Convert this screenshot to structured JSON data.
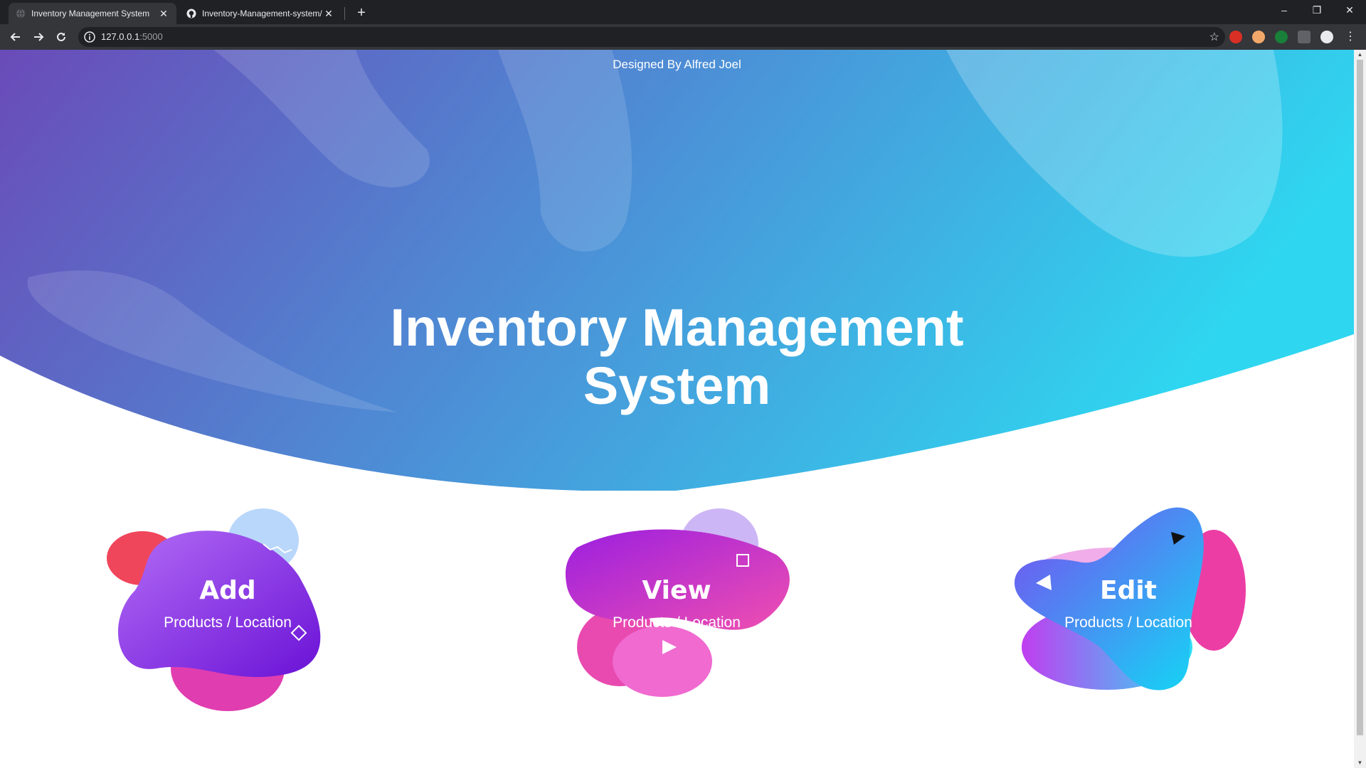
{
  "browser": {
    "tabs": [
      {
        "title": "Inventory Management System",
        "close": "✕"
      },
      {
        "title": "Inventory-Management-system/",
        "close": "✕"
      }
    ],
    "new_tab": "+",
    "url_host": "127.0.0.1",
    "url_port": ":5000",
    "bookmark_star": "☆",
    "controls": {
      "minimize": "–",
      "restore": "❐",
      "close": "✕"
    }
  },
  "hero": {
    "credit": "Designed By Alfred Joel",
    "title_line1": "Inventory Management",
    "title_line2": "System",
    "gradient_start": "#6a4bb8",
    "gradient_end": "#2fd6f0"
  },
  "cards": [
    {
      "title": "Add",
      "subtitle": "Products / Location"
    },
    {
      "title": "View",
      "subtitle": "Products / Location"
    },
    {
      "title": "Edit",
      "subtitle": "Products / Location"
    }
  ]
}
